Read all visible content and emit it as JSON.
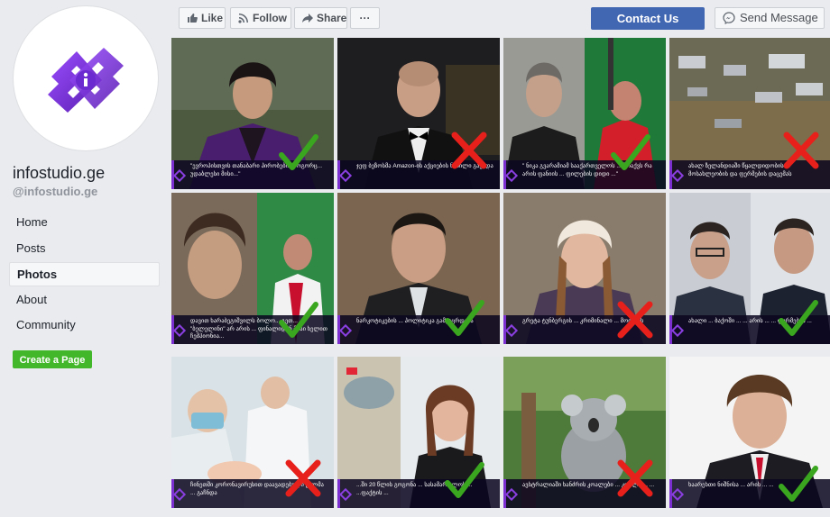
{
  "sidebar": {
    "page_name": "infostudio.ge",
    "page_handle": "@infostudio.ge",
    "nav": [
      {
        "label": "Home",
        "active": false
      },
      {
        "label": "Posts",
        "active": false
      },
      {
        "label": "Photos",
        "active": true
      },
      {
        "label": "About",
        "active": false
      },
      {
        "label": "Community",
        "active": false
      }
    ],
    "create_page_label": "Create a Page"
  },
  "actions": {
    "like_label": "Like",
    "follow_label": "Follow",
    "share_label": "Share",
    "more_label": "···",
    "contact_label": "Contact Us",
    "message_label": "Send Message"
  },
  "colors": {
    "accent": "#4267b2",
    "green": "#42b72a",
    "check": "#3aa51e",
    "cross": "#e8201b",
    "caption_border": "#7b2fd0"
  },
  "photos": [
    {
      "caption": "\"ევროპისთვის თანაბარი პირობები, როგორც... უდაბლესი მისი...\"",
      "verdict": "true"
    },
    {
      "caption": "ჯეფ ბეზოსმა Amazon-ის აქციების ნაწილი გაყიდა",
      "verdict": "false"
    },
    {
      "caption": "\" ნიკა გვარამიამ სააქართველოს ... მოაქვს რა არის ფანიის ... ფილების დიდი ...\"",
      "verdict": "true"
    },
    {
      "caption": "ახალ ზელანდიაში წყალდიდობის ... მოსახლეობის და ფერმების დაცემას",
      "verdict": "false"
    },
    {
      "caption": "დავით ხარაბეგიშვილს ბოლო... გეთ... \"ბელელინი\" არ არის ... ფინალიდან მისი ხელით ჩემპიონია...",
      "verdict": "true"
    },
    {
      "caption": "ნარკოტიკების ... პოლიტიკა გამკაცრდება",
      "verdict": "true"
    },
    {
      "caption": "გრეტა ტუნბერგის ... კრიმინალი ... მოიცავს",
      "verdict": "false"
    },
    {
      "caption": "ახალი ... ბაქოში ... ... არის ... ... ფირმების ...",
      "verdict": "true"
    },
    {
      "caption": "ჩინეთში კორონავირუსით დაავადებული ქალმა ... გაჩნდა",
      "verdict": "false"
    },
    {
      "caption": "...ში 20 წლის გოგონა ... სასამართლოს ... ...ფაქტის ...",
      "verdict": "true"
    },
    {
      "caption": "ავსტრალიაში ხანძრის კოალები ... კოალა ... ...",
      "verdict": "false"
    },
    {
      "caption": "ხაარეხთი ნიშნისა ... არის ... ...",
      "verdict": "true"
    }
  ]
}
